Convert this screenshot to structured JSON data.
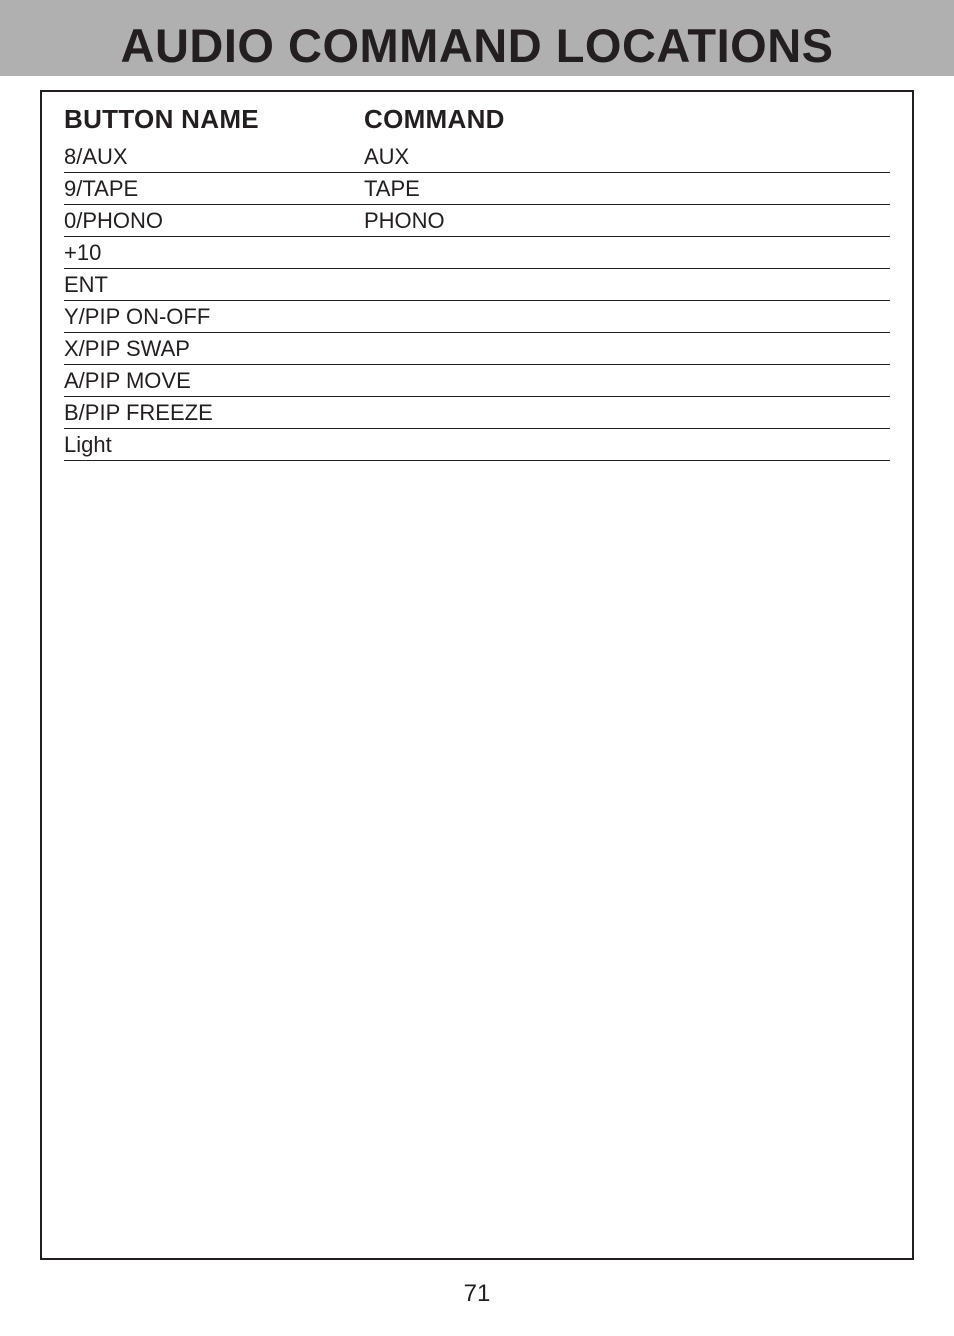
{
  "page": {
    "title": "AUDIO COMMAND LOCATIONS",
    "number": "71"
  },
  "table": {
    "headers": {
      "button_name": "BUTTON NAME",
      "command": "COMMAND"
    },
    "rows": [
      {
        "button_name": "8/AUX",
        "command": "AUX"
      },
      {
        "button_name": "9/TAPE",
        "command": "TAPE"
      },
      {
        "button_name": "0/PHONO",
        "command": "PHONO"
      },
      {
        "button_name": "+10",
        "command": ""
      },
      {
        "button_name": "ENT",
        "command": ""
      },
      {
        "button_name": "Y/PIP ON-OFF",
        "command": ""
      },
      {
        "button_name": "X/PIP SWAP",
        "command": ""
      },
      {
        "button_name": "A/PIP MOVE",
        "command": ""
      },
      {
        "button_name": "B/PIP FREEZE",
        "command": ""
      },
      {
        "button_name": "Light",
        "command": ""
      }
    ]
  }
}
